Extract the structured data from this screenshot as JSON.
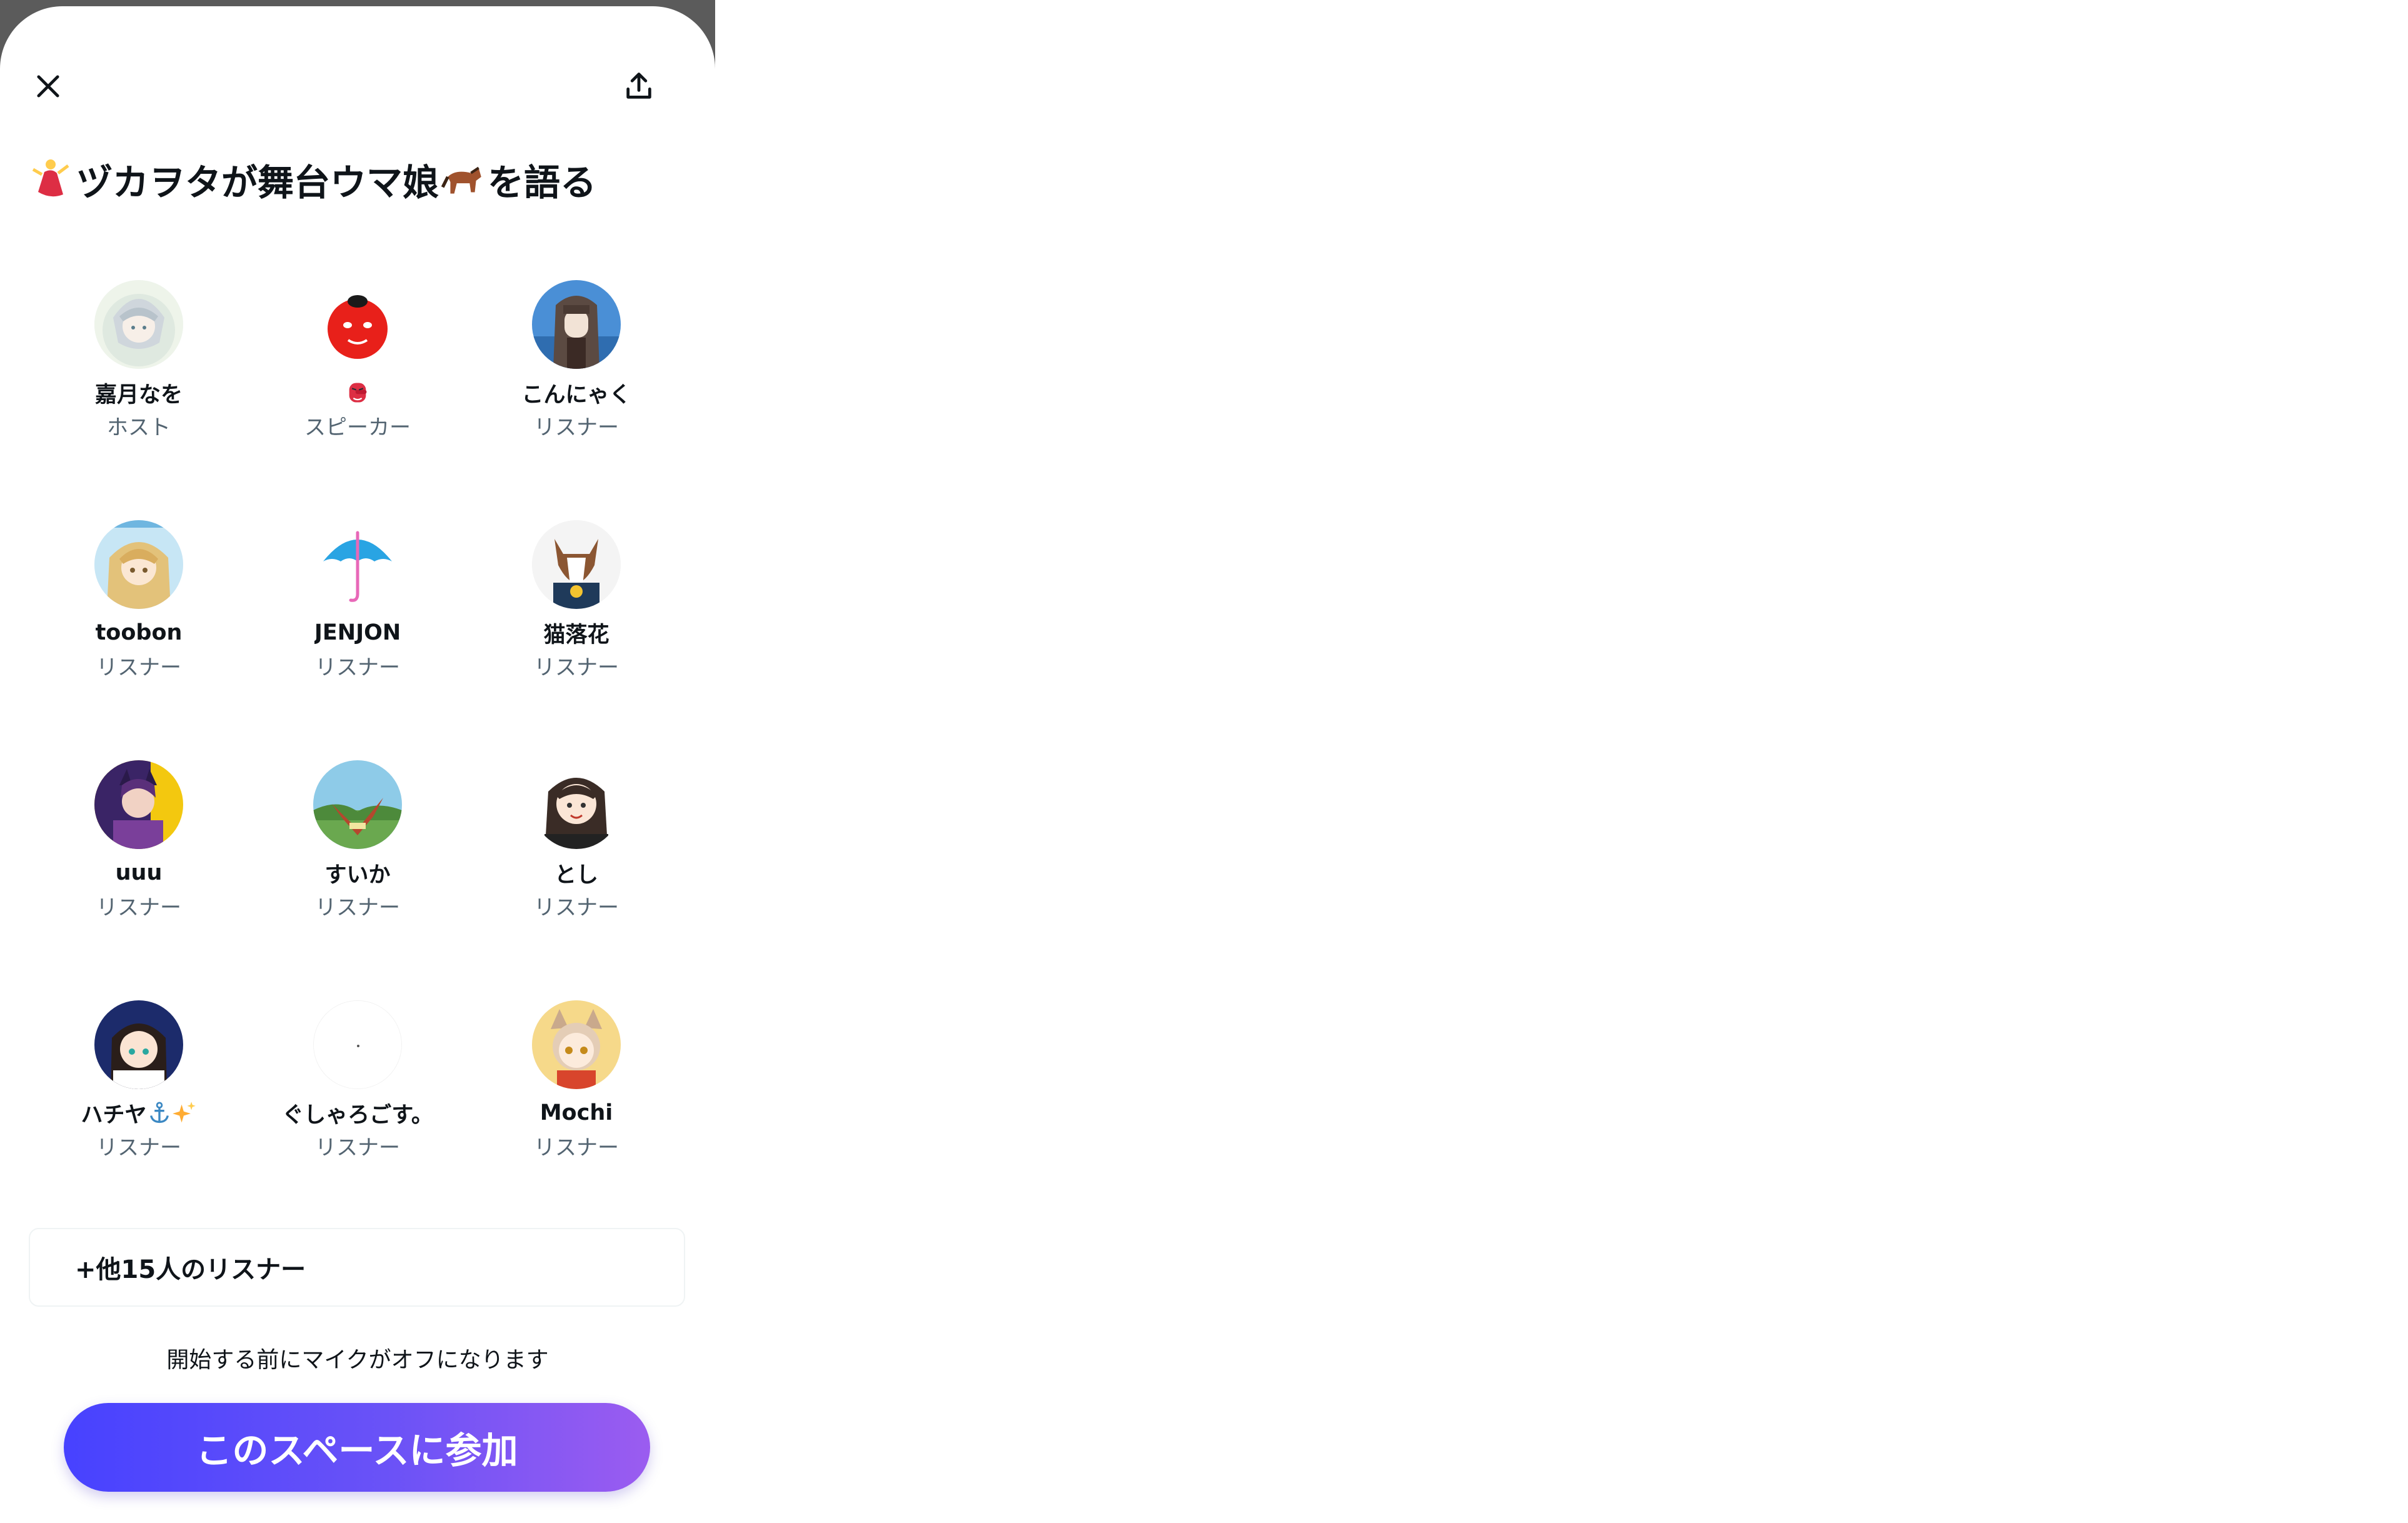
{
  "header": {
    "close_icon": "close-icon",
    "share_icon": "share-upload-icon"
  },
  "space": {
    "title_prefix_emoji": "dancer-emoji",
    "title_main": "ヅカヲタが舞台ウマ娘",
    "title_mid_emoji": "horse-emoji",
    "title_suffix": "を語る"
  },
  "participants": [
    {
      "name": "嘉月なを",
      "role": "ホスト",
      "avatar": "silver-haired-character-avatar"
    },
    {
      "name": "",
      "name_emoji": "tengu-mask-emoji",
      "role": "スピーカー",
      "avatar": "red-daruma-avatar"
    },
    {
      "name": "こんにゃく",
      "role": "リスナー",
      "avatar": "long-haired-character-avatar"
    },
    {
      "name": "toobon",
      "role": "リスナー",
      "avatar": "blonde-character-avatar"
    },
    {
      "name": "JENJON",
      "role": "リスナー",
      "avatar": "umbrella-avatar"
    },
    {
      "name": "猫落花",
      "role": "リスナー",
      "avatar": "horse-mascot-avatar"
    },
    {
      "name": "uuu",
      "role": "リスナー",
      "avatar": "purple-group-avatar"
    },
    {
      "name": "すいか",
      "role": "リスナー",
      "avatar": "landscape-art-avatar"
    },
    {
      "name": "とし",
      "role": "リスナー",
      "avatar": "chibi-character-avatar"
    },
    {
      "name": "ハチヤ",
      "name_emojis": [
        "anchor-emoji",
        "sparkles-emoji"
      ],
      "role": "リスナー",
      "avatar": "navy-haired-character-avatar"
    },
    {
      "name": "ぐしゃろごす。",
      "role": "リスナー",
      "avatar": "blank-white-avatar"
    },
    {
      "name": "Mochi",
      "role": "リスナー",
      "avatar": "fox-eared-character-avatar"
    }
  ],
  "more_listeners": "+他15人のリスナー",
  "mic_note": "開始する前にマイクがオフになります",
  "join_button": "このスペースに参加",
  "colors": {
    "join_gradient_start": "#4742ff",
    "join_gradient_end": "#9b5cf0",
    "role_text": "#536471"
  }
}
